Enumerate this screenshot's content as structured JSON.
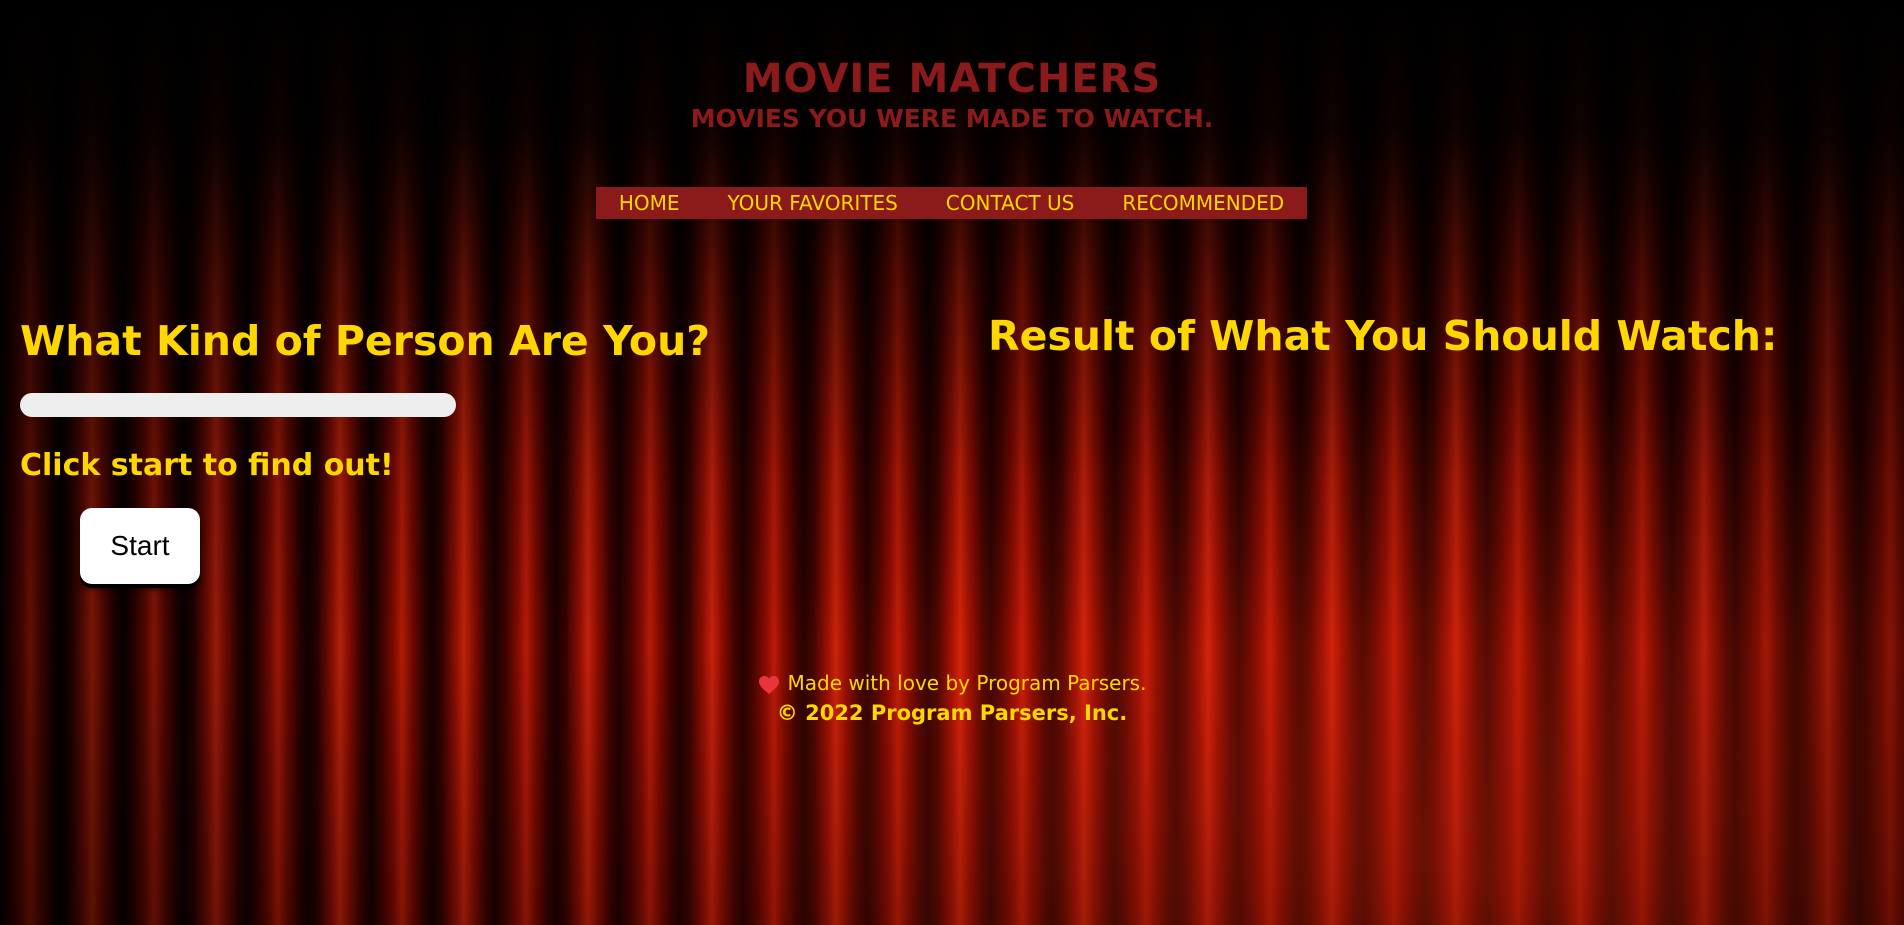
{
  "header": {
    "title": "MOVIE MATCHERS",
    "tagline": "MOVIES YOU WERE MADE TO WATCH."
  },
  "nav": {
    "items": [
      {
        "label": "HOME"
      },
      {
        "label": "YOUR FAVORITES"
      },
      {
        "label": "CONTACT US"
      },
      {
        "label": "RECOMMENDED"
      }
    ]
  },
  "quiz": {
    "heading": "What Kind of Person Are You?",
    "progress": 0,
    "prompt": "Click start to find out!",
    "start_label": "Start"
  },
  "result": {
    "heading": "Result of What You Should Watch:"
  },
  "footer": {
    "icon": "heart-icon",
    "made_with": "Made with love by Program Parsers.",
    "copyright": "© 2022 Program Parsers, Inc."
  },
  "colors": {
    "accent_gold": "#ffd700",
    "brand_red": "#8b1a1a",
    "heart": "#e8343a"
  }
}
